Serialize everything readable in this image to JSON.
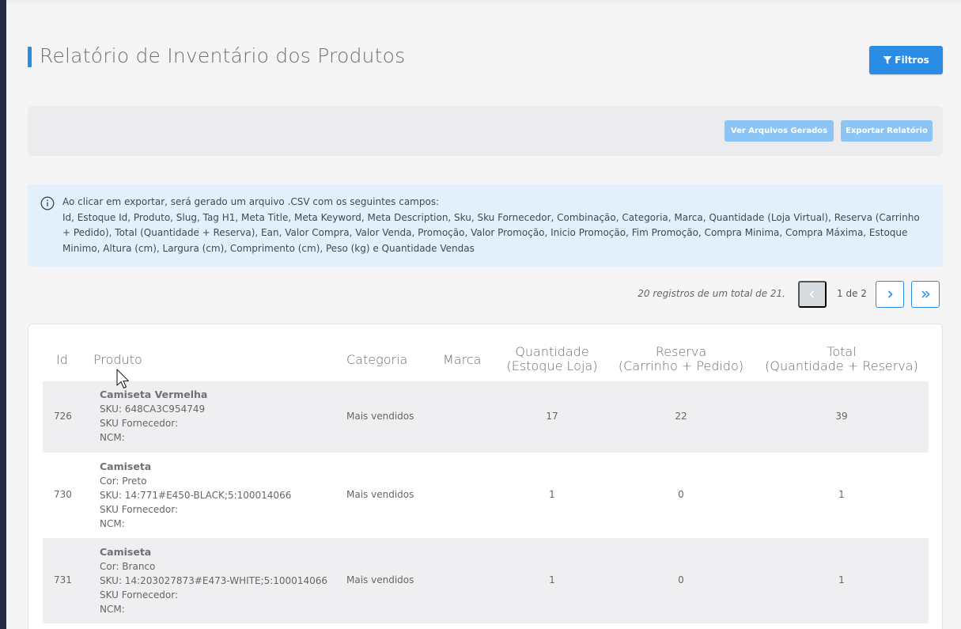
{
  "page": {
    "title": "Relatório de Inventário dos Produtos",
    "filter_label": "Filtros"
  },
  "actions": {
    "view_files": "Ver Arquivos Gerados",
    "export": "Exportar Relatório"
  },
  "info": {
    "line1": "Ao clicar em exportar, será gerado um arquivo .CSV com os seguintes campos:",
    "fields": "Id, Estoque Id, Produto, Slug, Tag H1, Meta Title, Meta Keyword, Meta Description, Sku, Sku Fornecedor, Combinação, Categoria, Marca, Quantidade (Loja Virtual), Reserva (Carrinho + Pedido), Total (Quantidade + Reserva), Ean, Valor Compra, Valor Venda, Promoção, Valor Promoção, Inicio Promoção, Fim Promoção, Compra Minima, Compra Máxima, Estoque Minimo, Altura (cm), Largura (cm), Comprimento (cm), Peso (kg) e Quantidade Vendas"
  },
  "pagination": {
    "summary": "20 registros de um total de 21.",
    "page": "1 de 2"
  },
  "table": {
    "headers": {
      "id": "Id",
      "product": "Produto",
      "category": "Categoria",
      "brand": "Marca",
      "qty_line1": "Quantidade",
      "qty_line2": "(Estoque Loja)",
      "reserve_line1": "Reserva",
      "reserve_line2": "(Carrinho + Pedido)",
      "total_line1": "Total",
      "total_line2": "(Quantidade + Reserva)"
    },
    "rows": [
      {
        "id": "726",
        "name": "Camiseta Vermelha",
        "details": [
          "SKU: 648CA3C954749",
          "SKU Fornecedor:",
          "NCM:"
        ],
        "category": "Mais vendidos",
        "brand": "",
        "qty": "17",
        "reserve": "22",
        "total": "39"
      },
      {
        "id": "730",
        "name": "Camiseta",
        "details": [
          "Cor: Preto",
          "SKU: 14:771#E450-BLACK;5:100014066",
          "SKU Fornecedor:",
          "NCM:"
        ],
        "category": "Mais vendidos",
        "brand": "",
        "qty": "1",
        "reserve": "0",
        "total": "1"
      },
      {
        "id": "731",
        "name": "Camiseta",
        "details": [
          "Cor: Branco",
          "SKU: 14:203027873#E473-WHITE;5:100014066",
          "SKU Fornecedor:",
          "NCM:"
        ],
        "category": "Mais vendidos",
        "brand": "",
        "qty": "1",
        "reserve": "0",
        "total": "1"
      }
    ]
  },
  "colors": {
    "accent": "#2b8ce6",
    "accent_light": "#8cc4f4",
    "info_bg": "#e3f0fb"
  },
  "icons": {
    "filter": "filter-icon",
    "info": "info-circle-icon",
    "prev": "chevron-left-icon",
    "next": "chevron-right-icon",
    "last": "chevrons-double-right-icon"
  }
}
